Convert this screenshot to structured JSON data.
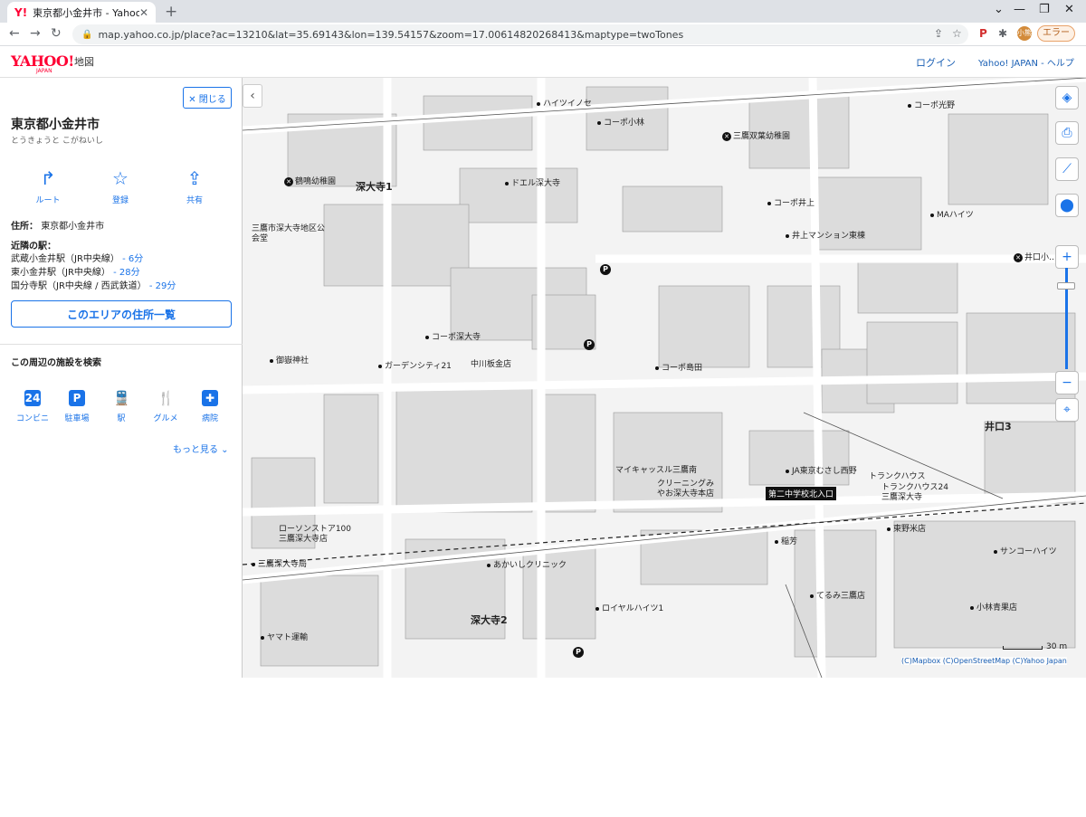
{
  "browser": {
    "tab_title": "東京都小金井市 - Yahoo!地図",
    "tab_favicon": "Y!",
    "url": "map.yahoo.co.jp/place?ac=13210&lat=35.69143&lon=139.54157&zoom=17.00614820268413&maptype=twoTones",
    "profile_initials": "小熊",
    "error_label": "エラー"
  },
  "header": {
    "logo": "YAHOO!",
    "logo_sub": "JAPAN",
    "service": "地図",
    "login": "ログイン",
    "links": "Yahoo! JAPAN - ヘルプ"
  },
  "panel": {
    "close_label": "✕ 閉じる",
    "title": "東京都小金井市",
    "reading": "とうきょうと こがねいし",
    "actions": [
      {
        "label": "ルート",
        "icon": "route-icon"
      },
      {
        "label": "登録",
        "icon": "star-icon"
      },
      {
        "label": "共有",
        "icon": "share-icon"
      }
    ],
    "address_label": "住所：",
    "address": "東京都小金井市",
    "stations_label": "近隣の駅：",
    "stations": [
      {
        "name": "武蔵小金井駅（JR中央線）",
        "minutes": "- 6分"
      },
      {
        "name": "東小金井駅（JR中央線）",
        "minutes": "- 28分"
      },
      {
        "name": "国分寺駅（JR中央線 / 西武鉄道）",
        "minutes": "- 29分"
      }
    ],
    "list_button": "このエリアの住所一覧",
    "search_heading": "この周辺の施設を検索",
    "categories": [
      {
        "label": "コンビニ",
        "icon": "24"
      },
      {
        "label": "駐車場",
        "icon": "P"
      },
      {
        "label": "駅",
        "icon": "🚆"
      },
      {
        "label": "グルメ",
        "icon": "🍴"
      },
      {
        "label": "病院",
        "icon": "✚"
      }
    ],
    "more": "もっと見る ⌄"
  },
  "map": {
    "areas": [
      "深大寺1",
      "深大寺2",
      "井口3"
    ],
    "pois": [
      "コーポ光野",
      "三鷹双葉幼稚園",
      "鶴鳴幼稚園",
      "ドエル深大寺",
      "コーポ井上",
      "MAハイツ",
      "井上マンション東棟",
      "井口小…",
      "三鷹市深大寺地区公会堂",
      "コーポ深大寺",
      "中川板金店",
      "ガーデンシティ21",
      "御嶽神社",
      "コーポ島田",
      "マイキャッスル三鷹南",
      "クリーニングみやお深大寺本店",
      "JA東京むさし西野",
      "トランクハウス24三鷹深大寺",
      "東野米店",
      "サンコーハイツ",
      "ローソンストア100 三鷹深大寺店",
      "三鷹深大寺局",
      "あかいしクリニック",
      "ロイヤルハイツ1",
      "ヤマト運輸",
      "てるみ三鷹店",
      "小林青果店",
      "コーポ小林",
      "ハイツイノセ",
      "稲芳",
      "トランクハウス"
    ],
    "bus_stop": "第二中学校北入口",
    "scale": "30 m",
    "attribution": "(C)Mapbox  (C)OpenStreetMap  (C)Yahoo Japan",
    "colors": {
      "background": "#f3f3f3",
      "building": "#d9d9d9",
      "road": "#ffffff",
      "accent": "#1a73e8",
      "brand": "#ff0033"
    }
  }
}
